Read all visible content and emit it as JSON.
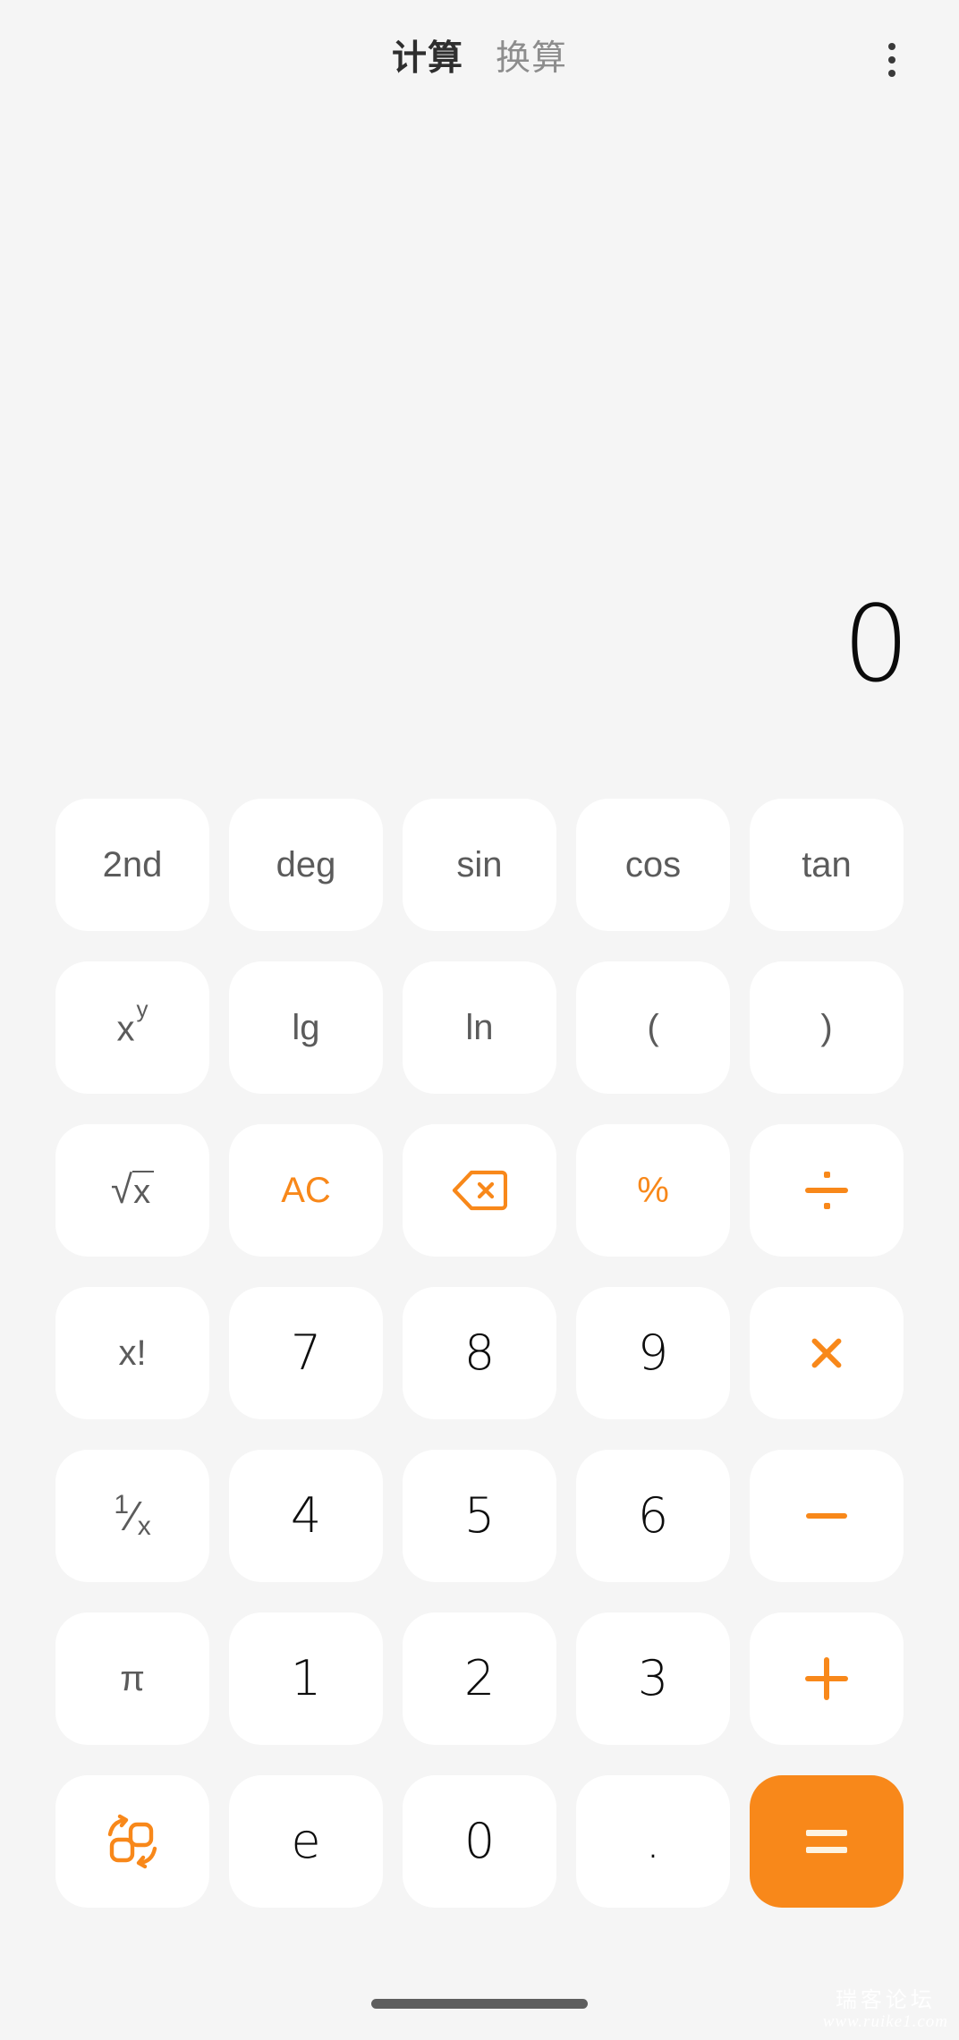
{
  "app": {
    "background_color": "#f5f5f5",
    "accent_color": "#f8881a",
    "key_color": "#ffffff"
  },
  "header": {
    "tabs": [
      {
        "label": "计算",
        "active": true
      },
      {
        "label": "换算",
        "active": false
      }
    ],
    "overflow_icon": "more-vertical-icon"
  },
  "display": {
    "value": "0"
  },
  "keypad": {
    "rows": [
      [
        {
          "name": "key-2nd",
          "label": "2nd",
          "style": "func"
        },
        {
          "name": "key-deg",
          "label": "deg",
          "style": "func"
        },
        {
          "name": "key-sin",
          "label": "sin",
          "style": "func"
        },
        {
          "name": "key-cos",
          "label": "cos",
          "style": "func"
        },
        {
          "name": "key-tan",
          "label": "tan",
          "style": "func"
        }
      ],
      [
        {
          "name": "key-power",
          "label": "x",
          "sup": "y",
          "style": "func"
        },
        {
          "name": "key-log10",
          "label": "lg",
          "style": "func"
        },
        {
          "name": "key-ln",
          "label": "ln",
          "style": "func"
        },
        {
          "name": "key-paren-open",
          "label": "(",
          "style": "func"
        },
        {
          "name": "key-paren-close",
          "label": ")",
          "style": "func"
        }
      ],
      [
        {
          "name": "key-sqrt",
          "label": "√x",
          "style": "func"
        },
        {
          "name": "key-all-clear",
          "label": "AC",
          "style": "accent"
        },
        {
          "name": "key-backspace",
          "label": "backspace-icon",
          "style": "accent-icon"
        },
        {
          "name": "key-percent",
          "label": "%",
          "style": "accent"
        },
        {
          "name": "key-divide",
          "label": "÷",
          "style": "accent-op"
        }
      ],
      [
        {
          "name": "key-factorial",
          "label": "x!",
          "style": "func"
        },
        {
          "name": "key-7",
          "label": "7",
          "style": "digit"
        },
        {
          "name": "key-8",
          "label": "8",
          "style": "digit"
        },
        {
          "name": "key-9",
          "label": "9",
          "style": "digit"
        },
        {
          "name": "key-multiply",
          "label": "×",
          "style": "accent-op"
        }
      ],
      [
        {
          "name": "key-reciprocal",
          "label": "1/x",
          "style": "func"
        },
        {
          "name": "key-4",
          "label": "4",
          "style": "digit"
        },
        {
          "name": "key-5",
          "label": "5",
          "style": "digit"
        },
        {
          "name": "key-6",
          "label": "6",
          "style": "digit"
        },
        {
          "name": "key-subtract",
          "label": "−",
          "style": "accent-op"
        }
      ],
      [
        {
          "name": "key-pi",
          "label": "π",
          "style": "func"
        },
        {
          "name": "key-1",
          "label": "1",
          "style": "digit"
        },
        {
          "name": "key-2",
          "label": "2",
          "style": "digit"
        },
        {
          "name": "key-3",
          "label": "3",
          "style": "digit"
        },
        {
          "name": "key-add",
          "label": "+",
          "style": "accent-op"
        }
      ],
      [
        {
          "name": "key-convert",
          "label": "swap-convert-icon",
          "style": "accent-icon"
        },
        {
          "name": "key-e",
          "label": "e",
          "style": "digit"
        },
        {
          "name": "key-0",
          "label": "0",
          "style": "digit"
        },
        {
          "name": "key-decimal",
          "label": ".",
          "style": "digit"
        },
        {
          "name": "key-equals",
          "label": "=",
          "style": "accent-fill"
        }
      ]
    ]
  },
  "watermark": {
    "cn": "瑞客论坛",
    "url": "www.ruike1.com"
  },
  "system": {
    "home_indicator": "home-indicator"
  }
}
